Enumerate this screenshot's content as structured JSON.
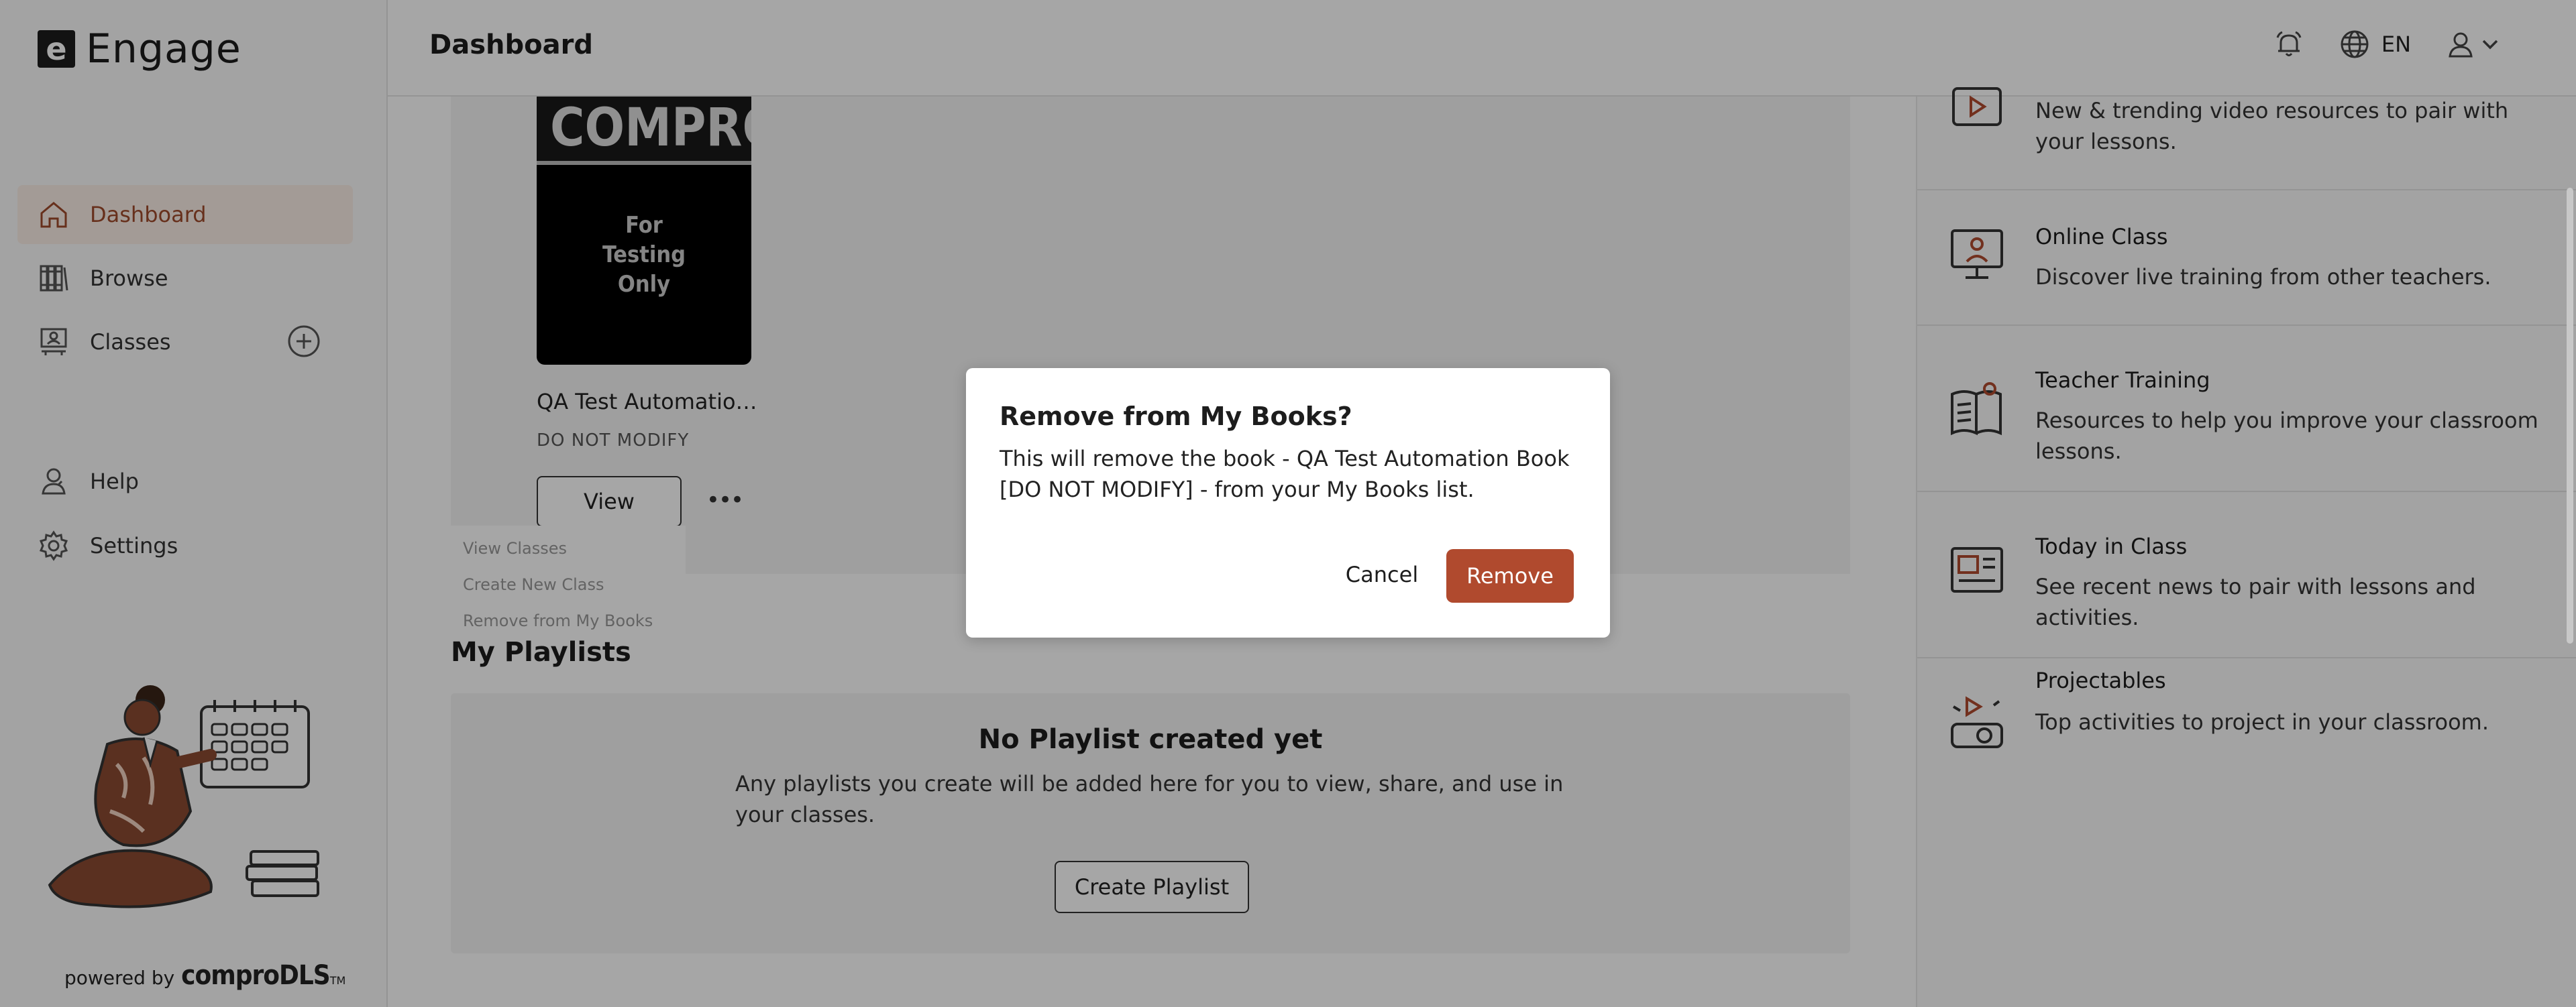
{
  "app": {
    "logo_letter": "e",
    "name": "Engage"
  },
  "sidebar": {
    "items": [
      {
        "label": "Dashboard",
        "icon": "home-icon",
        "active": true
      },
      {
        "label": "Browse",
        "icon": "books-icon"
      },
      {
        "label": "Classes",
        "icon": "class-icon"
      },
      {
        "label": "Help",
        "icon": "help-icon"
      },
      {
        "label": "Settings",
        "icon": "gear-icon"
      }
    ],
    "powered_by": "powered by",
    "powered_brand": "comproDLS",
    "powered_tm": "TM"
  },
  "header": {
    "title": "Dashboard",
    "language": "EN"
  },
  "book": {
    "cover_brand": "COMPRO",
    "cover_lines": [
      "For",
      "Testing",
      "Only"
    ],
    "title": "QA Test Automation Book",
    "subtitle": "DO NOT MODIFY",
    "view_label": "View",
    "more_label": "•••",
    "menu": [
      "View Classes",
      "Create New Class",
      "Remove from My Books"
    ]
  },
  "playlists": {
    "section_title": "My Playlists",
    "empty_title": "No Playlist created yet",
    "empty_desc": "Any playlists you create will be added here for you to view, share, and use in your classes.",
    "create_label": "Create Playlist"
  },
  "right_panel": {
    "items": [
      {
        "title": "",
        "desc": "New & trending video resources to pair with your lessons.",
        "icon": "video-icon"
      },
      {
        "title": "Online Class",
        "desc": "Discover live training from other teachers.",
        "icon": "online-class-icon"
      },
      {
        "title": "Teacher Training",
        "desc": "Resources to help you improve your classroom lessons.",
        "icon": "teacher-training-icon"
      },
      {
        "title": "Today in Class",
        "desc": "See recent news to pair with lessons and activities.",
        "icon": "today-in-class-icon"
      },
      {
        "title": "Projectables",
        "desc": "Top activities to project in your classroom.",
        "icon": "projector-icon"
      }
    ]
  },
  "modal": {
    "title": "Remove from My Books?",
    "body": "This will remove the book - QA Test Automation Book [DO NOT MODIFY] - from your My Books list.",
    "cancel_label": "Cancel",
    "remove_label": "Remove"
  },
  "colors": {
    "accent": "#B04A2E",
    "active_bg": "#FBEEE6"
  }
}
